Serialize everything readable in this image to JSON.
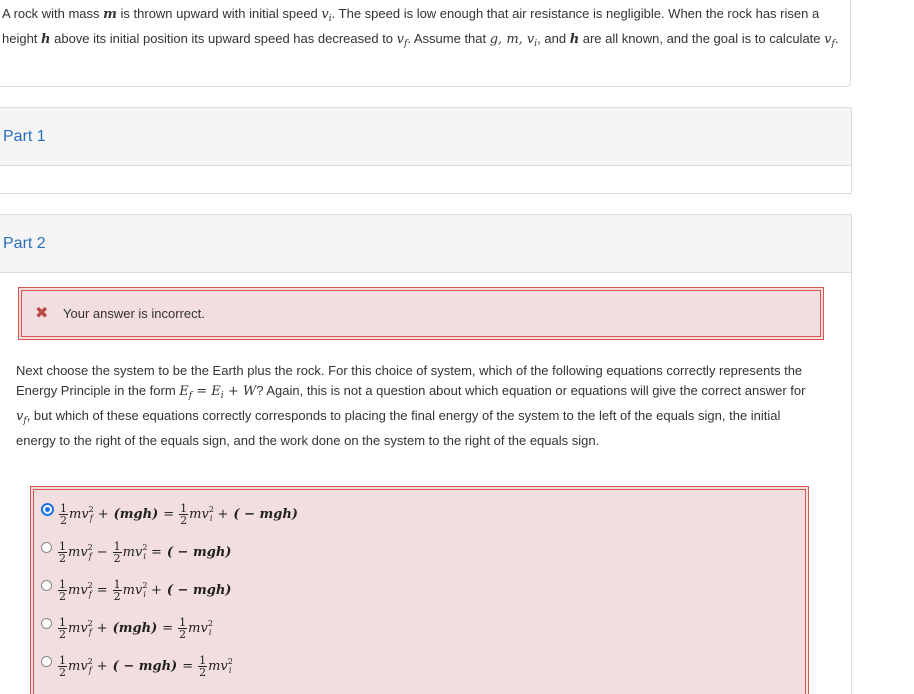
{
  "problem": {
    "seg1": "A rock with mass ",
    "m": "m",
    "seg2": " is thrown upward with initial speed ",
    "vi": "v",
    "vi_sub": "i",
    "seg3": ". The speed is low enough that air resistance is negligible. When the rock has risen a height ",
    "h": "h",
    "seg4": " above its initial position its upward speed has decreased to ",
    "vf": "v",
    "vf_sub": "f",
    "seg5": ". Assume that ",
    "known": "g, m, v",
    "known_sub": "i",
    "seg6": ", and ",
    "h2": "h",
    "seg7": " are all known, and the goal is to calculate ",
    "vf2": "v",
    "vf2_sub": "f",
    "seg8": "."
  },
  "parts": [
    {
      "title": "Part 1"
    },
    {
      "title": "Part 2"
    }
  ],
  "alert": {
    "text": "Your answer is incorrect."
  },
  "question": {
    "seg1": "Next choose the system to be the Earth plus the rock. For this choice of system, which of the following equations correctly represents the Energy Principle in the form ",
    "formula": "E",
    "f_sub": "f",
    "eq_mid": " = E",
    "i_sub": "i",
    "eq_end": " + W",
    "seg2": "? Again, this is not a question about which equation or equations will give the correct answer for ",
    "vf": "v",
    "vf_sub": "f",
    "seg3": ", but which of these equations correctly corresponds to placing the final energy of the system to the left of the equals sign, the initial energy to the right of the equals sign, and the work done on the system to the right of the equals sign."
  },
  "options": [
    {
      "selected": true,
      "parts": [
        "1",
        "2",
        "mv",
        "2",
        "f",
        " + ",
        "(mgh)",
        " = ",
        "1",
        "2",
        "mv",
        "2",
        "i",
        " + ",
        "( − mgh)"
      ]
    },
    {
      "selected": false,
      "parts": [
        "1",
        "2",
        "mv",
        "2",
        "f",
        " − ",
        "1",
        "2",
        "mv",
        "2",
        "i",
        " = ",
        "( − mgh)"
      ]
    },
    {
      "selected": false,
      "parts": [
        "1",
        "2",
        "mv",
        "2",
        "f",
        " = ",
        "1",
        "2",
        "mv",
        "2",
        "i",
        " + ",
        "( − mgh)"
      ]
    },
    {
      "selected": false,
      "parts": [
        "1",
        "2",
        "mv",
        "2",
        "f",
        " + ",
        "(mgh)",
        " = ",
        "1",
        "2",
        "mv",
        "2",
        "i"
      ]
    },
    {
      "selected": false,
      "parts": [
        "1",
        "2",
        "mv",
        "2",
        "f",
        " + ",
        "( − mgh)",
        " = ",
        "1",
        "2",
        "mv",
        "2",
        "i"
      ]
    }
  ]
}
